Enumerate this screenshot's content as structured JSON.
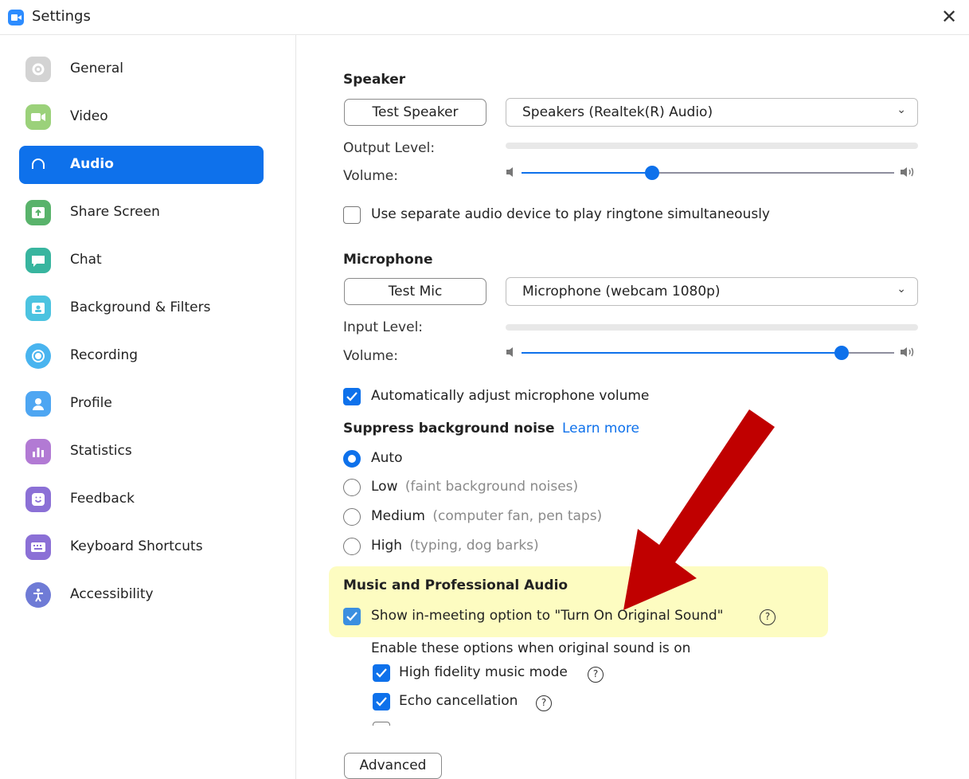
{
  "window": {
    "title": "Settings"
  },
  "sidebar": {
    "items": [
      {
        "label": "General",
        "icon": "gear-icon",
        "color": "#cfcfcf"
      },
      {
        "label": "Video",
        "icon": "video-camera-icon",
        "color": "#9bd17a"
      },
      {
        "label": "Audio",
        "icon": "headphones-icon",
        "color": "#0e71eb",
        "active": true
      },
      {
        "label": "Share Screen",
        "icon": "share-screen-icon",
        "color": "#59b36b"
      },
      {
        "label": "Chat",
        "icon": "chat-bubble-icon",
        "color": "#38b59f"
      },
      {
        "label": "Background & Filters",
        "icon": "background-icon",
        "color": "#4cc3e0"
      },
      {
        "label": "Recording",
        "icon": "record-icon",
        "color": "#49b4ef"
      },
      {
        "label": "Profile",
        "icon": "user-icon",
        "color": "#4ea6f2"
      },
      {
        "label": "Statistics",
        "icon": "bar-chart-icon",
        "color": "#b27ad4"
      },
      {
        "label": "Feedback",
        "icon": "smile-icon",
        "color": "#8b70d6"
      },
      {
        "label": "Keyboard Shortcuts",
        "icon": "keyboard-icon",
        "color": "#8b70d6"
      },
      {
        "label": "Accessibility",
        "icon": "accessibility-icon",
        "color": "#6f7bd6"
      }
    ]
  },
  "speaker": {
    "heading": "Speaker",
    "test_button": "Test Speaker",
    "device": "Speakers (Realtek(R) Audio)",
    "output_level_label": "Output Level:",
    "volume_label": "Volume:",
    "volume_fraction": 0.35
  },
  "ringtone": {
    "label": "Use separate audio device to play ringtone simultaneously",
    "checked": false
  },
  "microphone": {
    "heading": "Microphone",
    "test_button": "Test Mic",
    "device": "Microphone (webcam 1080p)",
    "input_level_label": "Input Level:",
    "volume_label": "Volume:",
    "volume_fraction": 0.86
  },
  "auto_adjust": {
    "label": "Automatically adjust microphone volume",
    "checked": true
  },
  "suppress": {
    "heading": "Suppress background noise",
    "learn_more": "Learn more",
    "options": [
      {
        "label": "Auto",
        "hint": "",
        "selected": true
      },
      {
        "label": "Low",
        "hint": "(faint background noises)",
        "selected": false
      },
      {
        "label": "Medium",
        "hint": "(computer fan, pen taps)",
        "selected": false
      },
      {
        "label": "High",
        "hint": "(typing, dog barks)",
        "selected": false
      }
    ]
  },
  "music": {
    "heading": "Music and Professional Audio",
    "original_sound_label": "Show in-meeting option to \"Turn On Original Sound\"",
    "sub_heading": "Enable these options when original sound is on",
    "hifi_label": "High fidelity music mode",
    "echo_label": "Echo cancellation"
  },
  "advanced_button": "Advanced",
  "colors": {
    "accent": "#0e71eb",
    "highlight": "#fdfcc1",
    "arrow": "#c00000"
  }
}
